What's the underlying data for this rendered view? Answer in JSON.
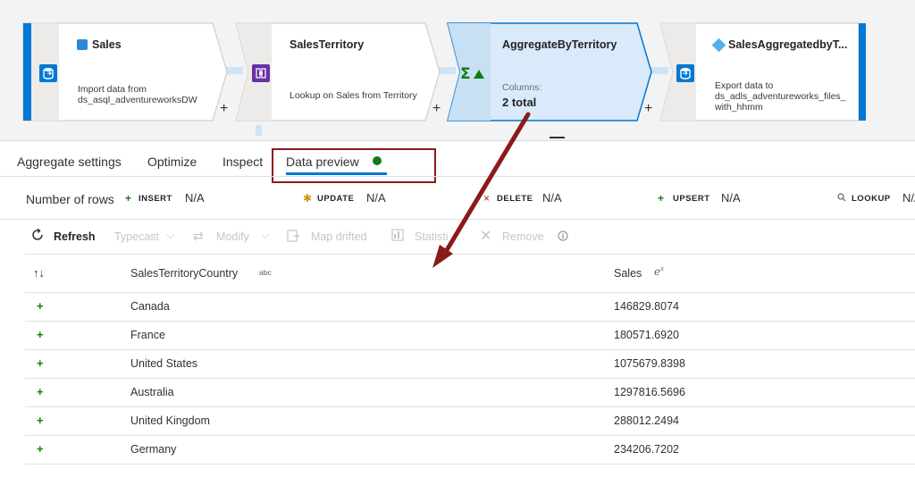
{
  "pipeline": {
    "nodes": [
      {
        "title": "Sales",
        "description": "Import data from ds_asql_adventureworksDW",
        "icon": "sql-database-icon",
        "plus": "+"
      },
      {
        "title": "SalesTerritory",
        "description": "Lookup on Sales from Territory",
        "icon": "lookup-icon",
        "plus": "+"
      },
      {
        "title": "AggregateByTerritory",
        "caption": "Columns:",
        "total": "2 total",
        "icon": "aggregate-sigma-icon",
        "plus": "+"
      },
      {
        "title": "SalesAggregatedbyT...",
        "description": "Export data to ds_adls_adventureworks_files_ with_hhmm",
        "icon": "sink-icon"
      }
    ]
  },
  "tabs": [
    "Aggregate settings",
    "Optimize",
    "Inspect",
    "Data preview"
  ],
  "active_tab": "Data preview",
  "counts": {
    "label": "Number of rows",
    "items": [
      {
        "kind": "INSERT",
        "value": "N/A",
        "icon": "insert-plus-icon",
        "color": "#107c10"
      },
      {
        "kind": "UPDATE",
        "value": "N/A",
        "icon": "update-asterisk-icon",
        "color": "#d39300"
      },
      {
        "kind": "DELETE",
        "value": "N/A",
        "icon": "delete-x-icon",
        "color": "#a4262c"
      },
      {
        "kind": "UPSERT",
        "value": "N/A",
        "icon": "upsert-icon",
        "color": "#107c10"
      },
      {
        "kind": "LOOKUP",
        "value": "N/A",
        "icon": "lookup-search-icon",
        "color": "#605e5c"
      }
    ]
  },
  "toolbar": {
    "refresh": "Refresh",
    "typecast": "Typecast",
    "modify": "Modify",
    "map_drifted": "Map drifted",
    "statistics": "Statisti",
    "remove": "Remove"
  },
  "grid": {
    "columns": [
      {
        "name": "SalesTerritoryCountry",
        "type_tag": "abc"
      },
      {
        "name": "Sales",
        "type_tag": "e^x"
      }
    ],
    "rows": [
      {
        "country": "Canada",
        "sales": "146829.8074"
      },
      {
        "country": "France",
        "sales": "180571.6920"
      },
      {
        "country": "United States",
        "sales": "1075679.8398"
      },
      {
        "country": "Australia",
        "sales": "1297816.5696"
      },
      {
        "country": "United Kingdom",
        "sales": "288012.2494"
      },
      {
        "country": "Germany",
        "sales": "234206.7202"
      }
    ]
  },
  "colors": {
    "accent": "#0078d4",
    "selected_node_fill": "#d9eafa",
    "annotation": "#8b1a1a",
    "status_green": "#107c10"
  }
}
